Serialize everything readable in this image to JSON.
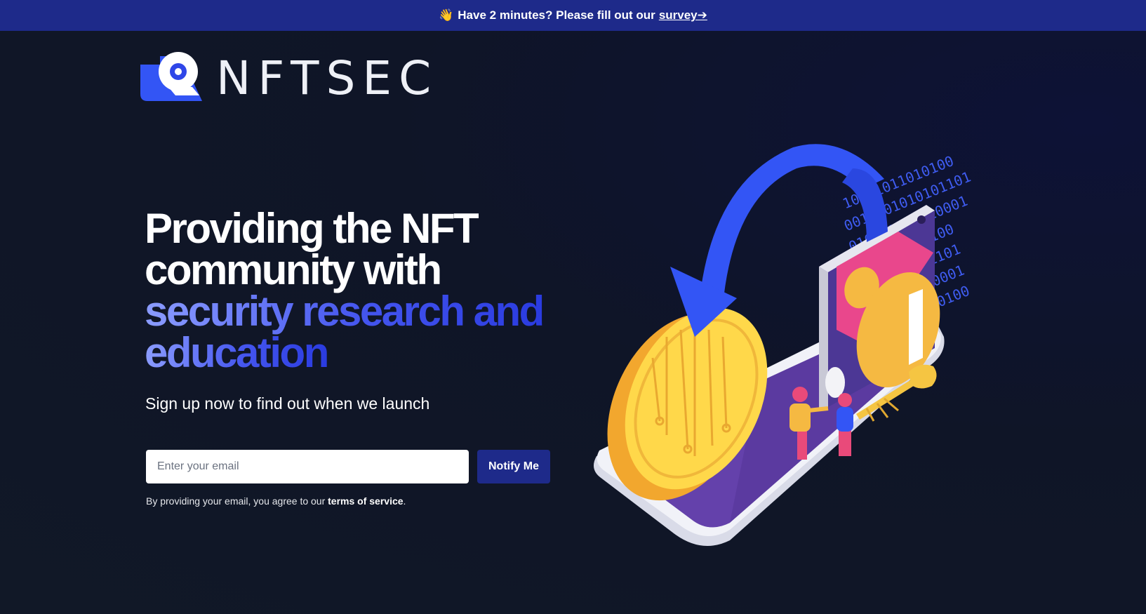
{
  "banner": {
    "emoji": "👋",
    "text": "Have 2 minutes? Please fill out our",
    "link_label": "survey➔"
  },
  "logo": {
    "text": "NFTSEC"
  },
  "hero": {
    "headline_line1": "Providing the NFT",
    "headline_line2": "community with",
    "headline_accent1": "security research and",
    "headline_accent2": "education",
    "subtitle": "Sign up now to find out when we launch"
  },
  "form": {
    "email_placeholder": "Enter your email",
    "email_value": "",
    "submit_label": "Notify Me"
  },
  "terms": {
    "prefix": "By providing your email, you agree to our",
    "link_label": "terms of service",
    "suffix": "."
  },
  "illustration": {
    "binary_rows": [
      "10001011010100",
      "0010101010101101",
      "010101010010001",
      "01010010100",
      "0101011101",
      "0100001",
      "00100"
    ]
  },
  "colors": {
    "banner": "#1e2a8a",
    "background": "#111827",
    "accent_light": "#8b9cff",
    "accent": "#2a3be0",
    "button": "#1e2a8a"
  }
}
